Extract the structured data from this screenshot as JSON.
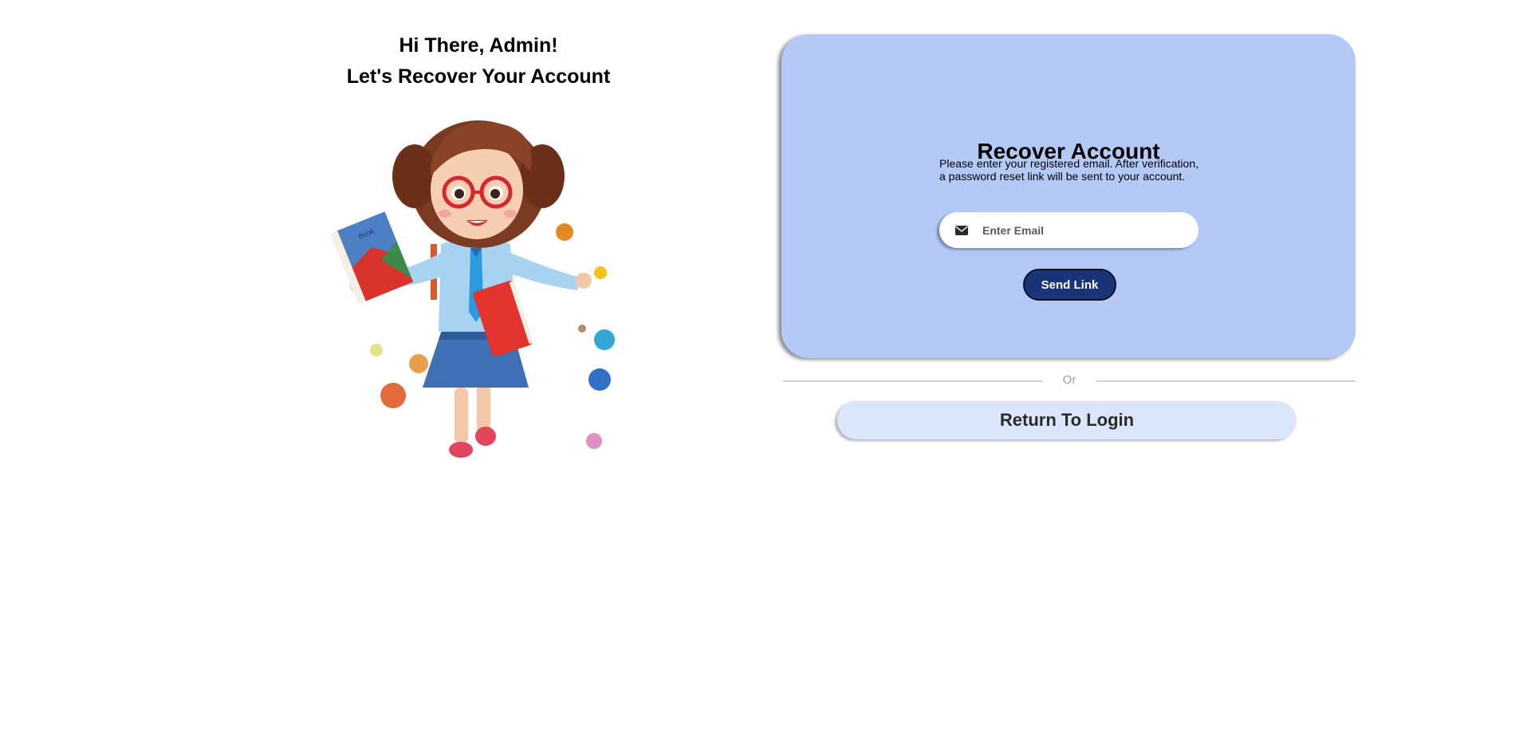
{
  "greeting": {
    "line1": "Hi There, Admin!",
    "line2": "Let's Recover Your Account"
  },
  "illustration": {
    "icon": "teacher-cartoon-illustration",
    "book_cover_text": "Book"
  },
  "card": {
    "title": "Recover Account",
    "description": "Please enter your registered email. After verification, a password reset link will be sent to your account.",
    "email_placeholder": "Enter Email",
    "email_value": "",
    "email_icon": "envelope-icon",
    "send_label": "Send Link"
  },
  "divider": {
    "label": "Or"
  },
  "return_label": "Return To Login",
  "colors": {
    "card_background": "#b5c9f7",
    "send_button": "#1a3478",
    "return_button": "#dce6fb",
    "divider_line": "#cfcfcf"
  }
}
